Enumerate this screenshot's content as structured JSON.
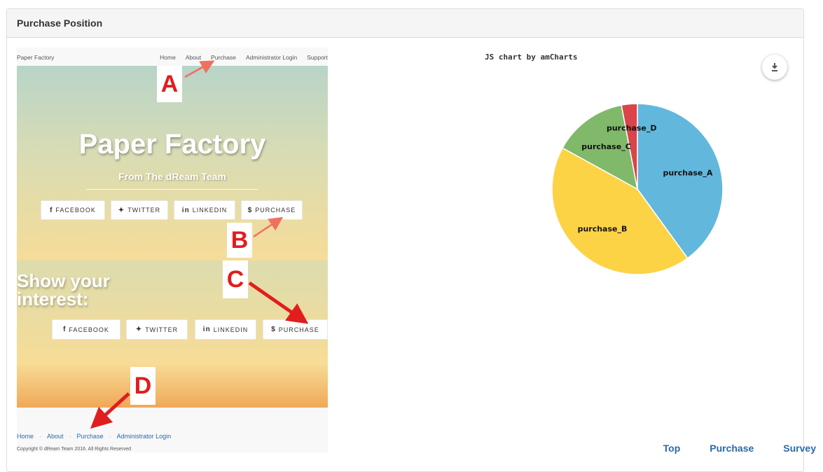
{
  "panel": {
    "title": "Purchase Position"
  },
  "screenshot": {
    "nav": {
      "brand": "Paper Factory",
      "links": [
        "Home",
        "About",
        "Purchase",
        "Administrator Login",
        "Support"
      ]
    },
    "hero": {
      "title": "Paper Factory",
      "subtitle": "From The dReam Team",
      "buttons": [
        {
          "icon": "f",
          "label": "FACEBOOK"
        },
        {
          "icon": "✦",
          "label": "TWITTER"
        },
        {
          "icon": "in",
          "label": "LINKEDIN"
        },
        {
          "icon": "$",
          "label": "PURCHASE"
        }
      ]
    },
    "interest": {
      "title_line1": "Show your",
      "title_line2": "interest:",
      "buttons": [
        {
          "icon": "f",
          "label": "FACEBOOK"
        },
        {
          "icon": "✦",
          "label": "TWITTER"
        },
        {
          "icon": "in",
          "label": "LINKEDIN"
        },
        {
          "icon": "$",
          "label": "PURCHASE"
        }
      ]
    },
    "footer": {
      "links": [
        "Home",
        "About",
        "Purchase",
        "Administrator Login"
      ],
      "separator": "·",
      "copyright": "Copyright © dReam Team 2016. All Rights Reserved"
    },
    "annotations": [
      "A",
      "B",
      "C",
      "D"
    ],
    "colors": {
      "annotation_red": "#e11d1d",
      "arrow_salmon": "#f07060"
    }
  },
  "chart": {
    "credit": "JS chart by amCharts",
    "download_icon": "download-icon"
  },
  "chart_data": {
    "type": "pie",
    "labels": [
      "purchase_A",
      "purchase_B",
      "purchase_C",
      "purchase_D"
    ],
    "values": [
      40,
      43,
      14,
      3
    ],
    "colors": [
      "#62b7dc",
      "#fdd346",
      "#80b96a",
      "#d9454a"
    ]
  },
  "bottom_nav": {
    "items": [
      "Top",
      "Purchase",
      "Survey"
    ]
  }
}
